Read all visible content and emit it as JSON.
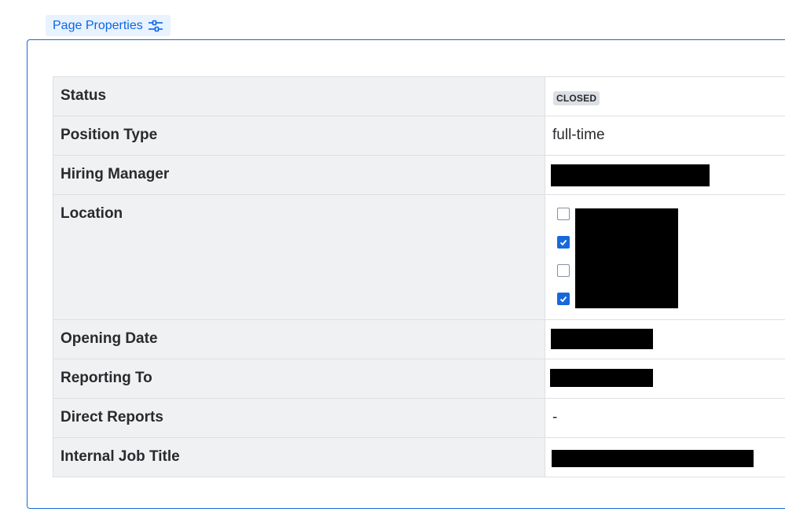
{
  "header": {
    "page_properties_label": "Page Properties",
    "page_properties_icon": "sliders-icon"
  },
  "properties": {
    "status": {
      "key": "Status",
      "value": "CLOSED"
    },
    "position_type": {
      "key": "Position Type",
      "value": "full-time"
    },
    "hiring_manager": {
      "key": "Hiring Manager"
    },
    "location": {
      "key": "Location",
      "checkboxes": [
        {
          "checked": false
        },
        {
          "checked": true
        },
        {
          "checked": false
        },
        {
          "checked": true
        }
      ]
    },
    "opening_date": {
      "key": "Opening Date"
    },
    "reporting_to": {
      "key": "Reporting To"
    },
    "direct_reports": {
      "key": "Direct Reports",
      "value": "-"
    },
    "internal_job_title": {
      "key": "Internal Job Title"
    }
  },
  "colors": {
    "accent": "#0c66e4",
    "panel_border": "#1868db",
    "checkbox_checked": "#1868db",
    "key_background": "#f0f1f2",
    "lozenge_background": "#dcdfe4"
  }
}
